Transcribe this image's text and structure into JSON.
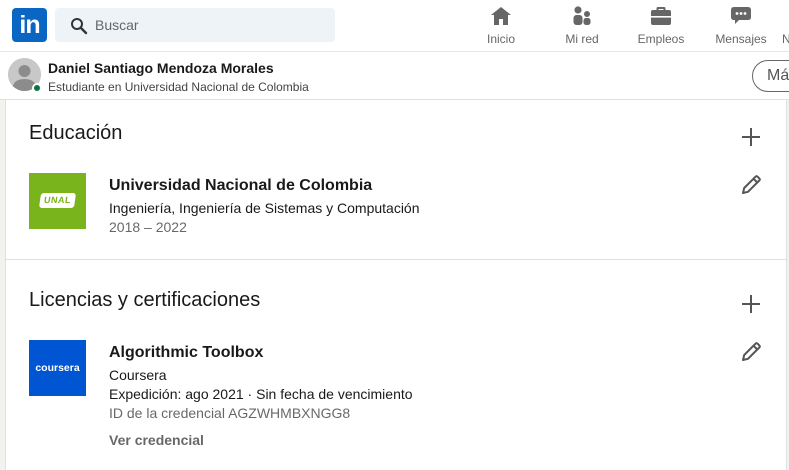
{
  "nav": {
    "logo_text": "in",
    "search_placeholder": "Buscar",
    "items": [
      {
        "label": "Inicio",
        "icon": "home-icon"
      },
      {
        "label": "Mi red",
        "icon": "network-icon"
      },
      {
        "label": "Empleos",
        "icon": "briefcase-icon"
      },
      {
        "label": "Mensajes",
        "icon": "messaging-icon"
      }
    ],
    "cut_label": "N"
  },
  "profile": {
    "name": "Daniel Santiago Mendoza Morales",
    "headline": "Estudiante en Universidad Nacional de Colombia",
    "more_button": "Má"
  },
  "education": {
    "title": "Educación",
    "entries": [
      {
        "logo_text": "UNAL",
        "school": "Universidad Nacional de Colombia",
        "degree": "Ingeniería, Ingeniería de Sistemas y Computación",
        "dates": "2018 – 2022"
      }
    ]
  },
  "certifications": {
    "title": "Licencias y certificaciones",
    "entries": [
      {
        "logo_text": "coursera",
        "name": "Algorithmic Toolbox",
        "issuer": "Coursera",
        "issued": "Expedición: ago 2021 · Sin fecha de vencimiento",
        "credential_id": "ID de la credencial AGZWHMBXNGG8",
        "link": "Ver credencial"
      }
    ]
  },
  "colors": {
    "brand": "#0a66c2",
    "unal_green": "#7ab41d",
    "coursera_blue": "#0056d2",
    "presence": "#057642"
  }
}
